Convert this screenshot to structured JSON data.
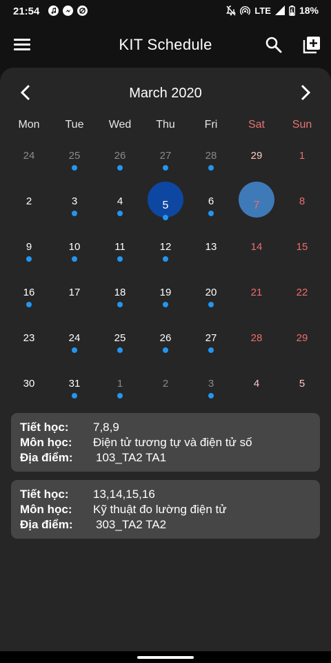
{
  "status_bar": {
    "time": "21:54",
    "network": "LTE",
    "battery": "18%",
    "left_icons": [
      "music-icon",
      "messenger-icon",
      "data-saver-icon"
    ],
    "right_icons": [
      "mute-icon",
      "hotspot-icon",
      "lte-icon",
      "signal-icon",
      "battery-icon"
    ]
  },
  "app_bar": {
    "title": "KIT Schedule",
    "icons": [
      "menu-icon",
      "search-icon",
      "add-box-icon"
    ]
  },
  "calendar": {
    "month_title": "March 2020",
    "weekdays": [
      "Mon",
      "Tue",
      "Wed",
      "Thu",
      "Fri",
      "Sat",
      "Sun"
    ],
    "today_day": "5",
    "selected_day": "7",
    "weeks": [
      [
        {
          "d": "24",
          "other": true,
          "dot": false
        },
        {
          "d": "25",
          "other": true,
          "dot": true
        },
        {
          "d": "26",
          "other": true,
          "dot": true
        },
        {
          "d": "27",
          "other": true,
          "dot": true
        },
        {
          "d": "28",
          "other": true,
          "dot": true
        },
        {
          "d": "29",
          "other": true,
          "dot": false
        },
        {
          "d": "1",
          "other": false,
          "dot": false
        }
      ],
      [
        {
          "d": "2",
          "other": false,
          "dot": false
        },
        {
          "d": "3",
          "other": false,
          "dot": true
        },
        {
          "d": "4",
          "other": false,
          "dot": true
        },
        {
          "d": "5",
          "other": false,
          "dot": true
        },
        {
          "d": "6",
          "other": false,
          "dot": true
        },
        {
          "d": "7",
          "other": false,
          "dot": false
        },
        {
          "d": "8",
          "other": false,
          "dot": false
        }
      ],
      [
        {
          "d": "9",
          "other": false,
          "dot": true
        },
        {
          "d": "10",
          "other": false,
          "dot": true
        },
        {
          "d": "11",
          "other": false,
          "dot": true
        },
        {
          "d": "12",
          "other": false,
          "dot": true
        },
        {
          "d": "13",
          "other": false,
          "dot": false
        },
        {
          "d": "14",
          "other": false,
          "dot": false
        },
        {
          "d": "15",
          "other": false,
          "dot": false
        }
      ],
      [
        {
          "d": "16",
          "other": false,
          "dot": true
        },
        {
          "d": "17",
          "other": false,
          "dot": false
        },
        {
          "d": "18",
          "other": false,
          "dot": true
        },
        {
          "d": "19",
          "other": false,
          "dot": true
        },
        {
          "d": "20",
          "other": false,
          "dot": true
        },
        {
          "d": "21",
          "other": false,
          "dot": false
        },
        {
          "d": "22",
          "other": false,
          "dot": false
        }
      ],
      [
        {
          "d": "23",
          "other": false,
          "dot": false
        },
        {
          "d": "24",
          "other": false,
          "dot": true
        },
        {
          "d": "25",
          "other": false,
          "dot": true
        },
        {
          "d": "26",
          "other": false,
          "dot": true
        },
        {
          "d": "27",
          "other": false,
          "dot": true
        },
        {
          "d": "28",
          "other": false,
          "dot": false
        },
        {
          "d": "29",
          "other": false,
          "dot": false
        }
      ],
      [
        {
          "d": "30",
          "other": false,
          "dot": false
        },
        {
          "d": "31",
          "other": false,
          "dot": true
        },
        {
          "d": "1",
          "other": true,
          "dot": true
        },
        {
          "d": "2",
          "other": true,
          "dot": false
        },
        {
          "d": "3",
          "other": true,
          "dot": true
        },
        {
          "d": "4",
          "other": true,
          "dot": false
        },
        {
          "d": "5",
          "other": true,
          "dot": false
        }
      ]
    ]
  },
  "events": [
    {
      "period_label": "Tiết học:",
      "period": "7,8,9",
      "subject_label": "Môn học:",
      "subject": "Điện tử tương tự và điện tử số",
      "location_label": "Địa điểm:",
      "location": "103_TA2 TA1"
    },
    {
      "period_label": "Tiết học:",
      "period": "13,14,15,16",
      "subject_label": "Môn học:",
      "subject": "Kỹ thuật đo lường điện tử",
      "location_label": "Địa điểm:",
      "location": "303_TA2 TA2"
    }
  ],
  "colors": {
    "background": "#121212",
    "card": "#262626",
    "event_card": "#464646",
    "accent_dot": "#2196f3",
    "today_circle": "#0d47a1",
    "selected_circle": "#3f7ab8",
    "weekend": "#ef6c6c"
  }
}
